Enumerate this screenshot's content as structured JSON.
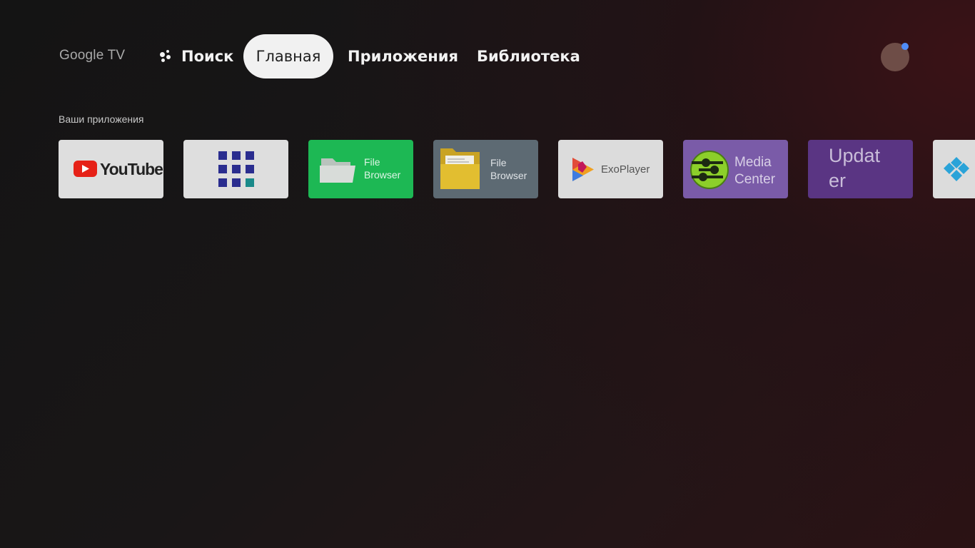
{
  "header": {
    "brand": "Google TV",
    "nav": {
      "search": "Поиск",
      "home": "Главная",
      "apps": "Приложения",
      "library": "Библиотека"
    },
    "active_tab": "home"
  },
  "apps_section": {
    "title": "Ваши приложения",
    "tiles": [
      {
        "id": "youtube",
        "label": "YouTube",
        "bg": "#dedede"
      },
      {
        "id": "apps-grid",
        "label": "",
        "bg": "#dedede"
      },
      {
        "id": "file-browser-green",
        "label": "File\nBrowser",
        "bg": "#1db854"
      },
      {
        "id": "file-browser-folder",
        "label": "File\nBrowser",
        "bg": "#5d6a73"
      },
      {
        "id": "exoplayer",
        "label": "ExoPlayer",
        "bg": "#dcdcdc"
      },
      {
        "id": "media-center",
        "label": "Media\nCenter",
        "bg": "#7a5ba8"
      },
      {
        "id": "updater",
        "label": "Updat\ner",
        "bg": "#5a3583"
      },
      {
        "id": "kodi",
        "label": "",
        "bg": "#dcdcdc"
      }
    ]
  },
  "colors": {
    "accent_notification": "#4f8cf7",
    "youtube_red": "#e62117",
    "grid_blue": "#2a2d8f",
    "grid_teal": "#1a8a8a"
  }
}
